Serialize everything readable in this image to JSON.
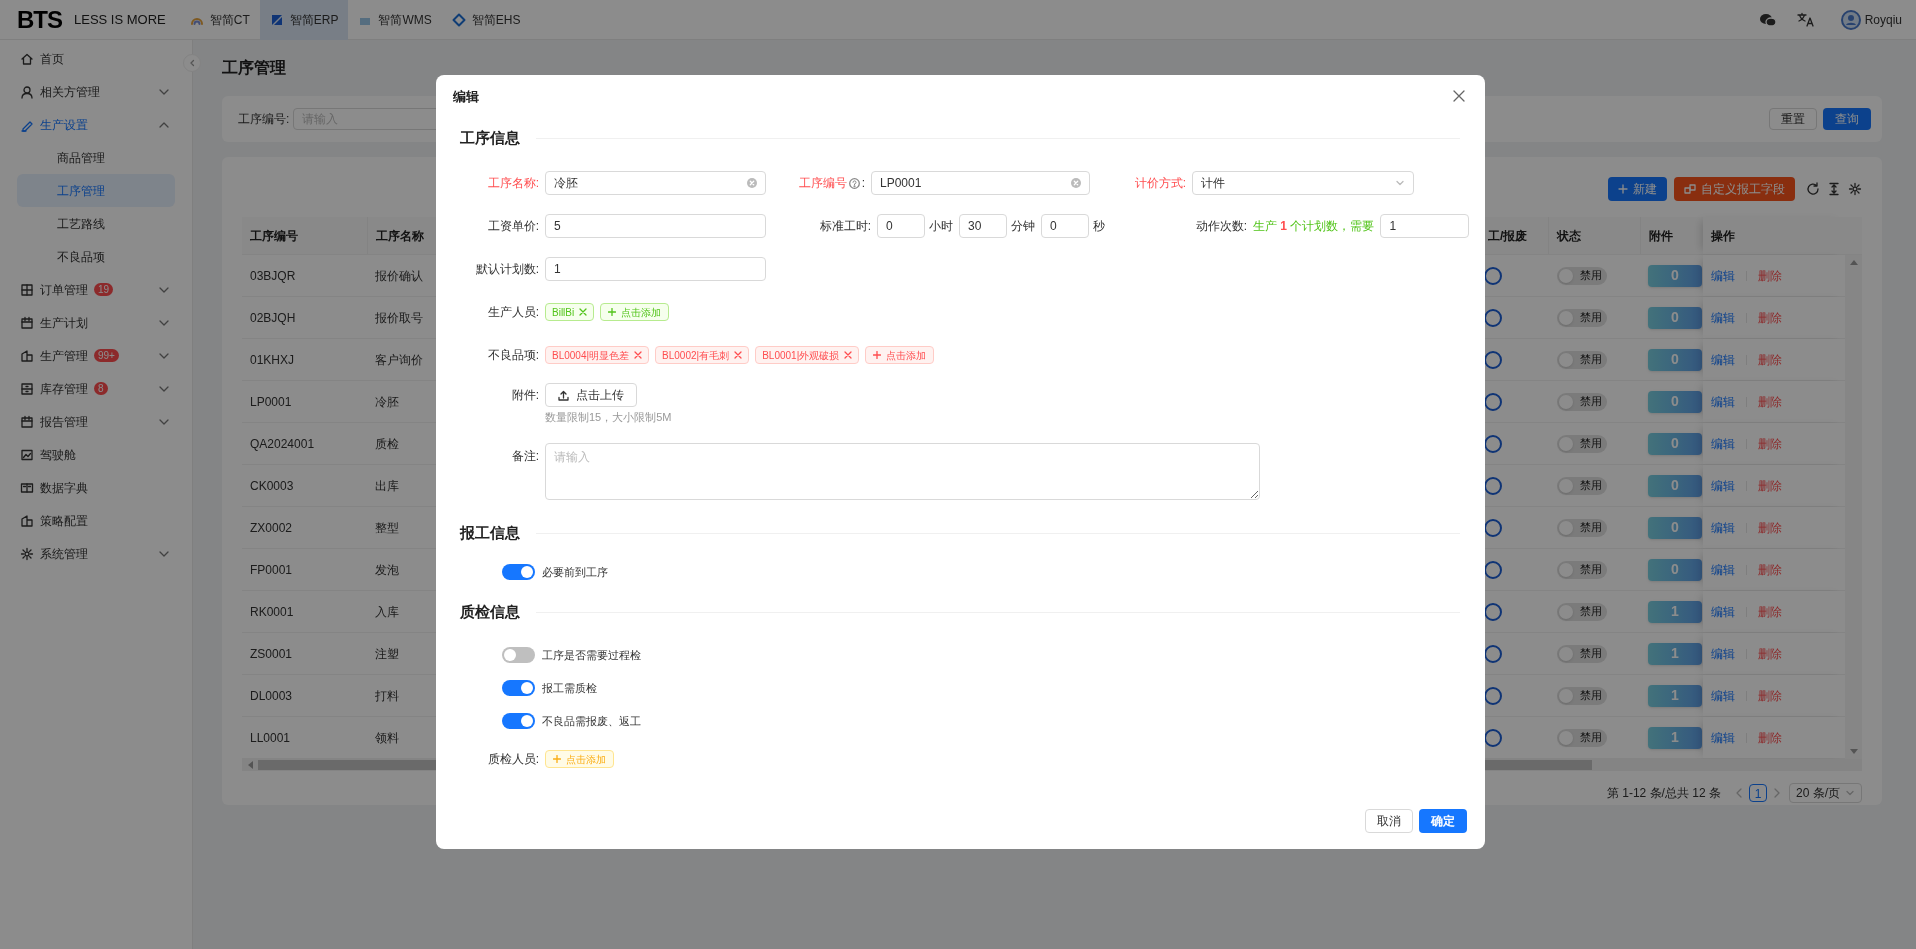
{
  "topbar": {
    "logo": "BTS",
    "slogan": "LESS IS MORE",
    "apps": [
      {
        "label": "智简CT",
        "selected": false
      },
      {
        "label": "智简ERP",
        "selected": true
      },
      {
        "label": "智简WMS",
        "selected": false
      },
      {
        "label": "智简EHS",
        "selected": false
      }
    ],
    "user": "Royqiu"
  },
  "sidebar": {
    "items": [
      {
        "label": "首页",
        "selected": false
      },
      {
        "label": "相关方管理",
        "selected": false,
        "expanded": false
      },
      {
        "label": "生产设置",
        "selected": true,
        "expanded": true,
        "children": [
          {
            "label": "商品管理",
            "selected": false
          },
          {
            "label": "工序管理",
            "selected": true
          },
          {
            "label": "工艺路线",
            "selected": false
          },
          {
            "label": "不良品项",
            "selected": false
          }
        ]
      },
      {
        "label": "订单管理",
        "selected": false,
        "expanded": false,
        "badge": "19"
      },
      {
        "label": "生产计划",
        "selected": false,
        "expanded": false
      },
      {
        "label": "生产管理",
        "selected": false,
        "expanded": false,
        "badge": "99+"
      },
      {
        "label": "库存管理",
        "selected": false,
        "expanded": false,
        "badge": "8"
      },
      {
        "label": "报告管理",
        "selected": false,
        "expanded": false
      },
      {
        "label": "驾驶舱",
        "selected": false
      },
      {
        "label": "数据字典",
        "selected": false
      },
      {
        "label": "策略配置",
        "selected": false
      },
      {
        "label": "系统管理",
        "selected": false,
        "expanded": false
      }
    ]
  },
  "page_title": "工序管理",
  "filter": {
    "label": "工序编号:",
    "placeholder": "请输入",
    "buttons": [
      {
        "label": "重置",
        "primary": false
      },
      {
        "label": "查询",
        "primary": true
      }
    ]
  },
  "toolbar": {
    "new_button": "新建",
    "custom_button": "自定义报工字段"
  },
  "table": {
    "columns": [
      "工序编号",
      "工序名称",
      "工/报废",
      "状态",
      "附件",
      "操作"
    ],
    "rows": [
      {
        "code": "03BJQR",
        "name": "报价确认",
        "status": {
          "on": false,
          "label": "禁用"
        },
        "attachments": "0",
        "actions": [
          "编辑",
          "删除"
        ]
      },
      {
        "code": "02BJQH",
        "name": "报价取号",
        "status": {
          "on": false,
          "label": "禁用"
        },
        "attachments": "0",
        "actions": [
          "编辑",
          "删除"
        ]
      },
      {
        "code": "01KHXJ",
        "name": "客户询价",
        "status": {
          "on": false,
          "label": "禁用"
        },
        "attachments": "0",
        "actions": [
          "编辑",
          "删除"
        ]
      },
      {
        "code": "LP0001",
        "name": "冷胚",
        "status": {
          "on": false,
          "label": "禁用"
        },
        "attachments": "0",
        "actions": [
          "编辑",
          "删除"
        ]
      },
      {
        "code": "QA2024001",
        "name": "质检",
        "status": {
          "on": false,
          "label": "禁用"
        },
        "attachments": "0",
        "actions": [
          "编辑",
          "删除"
        ]
      },
      {
        "code": "CK0003",
        "name": "出库",
        "status": {
          "on": false,
          "label": "禁用"
        },
        "attachments": "0",
        "actions": [
          "编辑",
          "删除"
        ]
      },
      {
        "code": "ZX0002",
        "name": "整型",
        "status": {
          "on": false,
          "label": "禁用"
        },
        "attachments": "0",
        "actions": [
          "编辑",
          "删除"
        ]
      },
      {
        "code": "FP0001",
        "name": "发泡",
        "status": {
          "on": false,
          "label": "禁用"
        },
        "attachments": "0",
        "actions": [
          "编辑",
          "删除"
        ]
      },
      {
        "code": "RK0001",
        "name": "入库",
        "status": {
          "on": false,
          "label": "禁用"
        },
        "attachments": "1",
        "actions": [
          "编辑",
          "删除"
        ]
      },
      {
        "code": "ZS0001",
        "name": "注塑",
        "status": {
          "on": false,
          "label": "禁用"
        },
        "attachments": "1",
        "actions": [
          "编辑",
          "删除"
        ]
      },
      {
        "code": "DL0003",
        "name": "打料",
        "status": {
          "on": false,
          "label": "禁用"
        },
        "attachments": "1",
        "actions": [
          "编辑",
          "删除"
        ]
      },
      {
        "code": "LL0001",
        "name": "领料",
        "status": {
          "on": false,
          "label": "禁用"
        },
        "attachments": "1",
        "actions": [
          "编辑",
          "删除"
        ]
      }
    ]
  },
  "pagination": {
    "summary": "第 1-12 条/总共 12 条",
    "pages": [
      {
        "label": "1",
        "selected": true
      }
    ],
    "page_size": "20 条/页"
  },
  "modal": {
    "title": "编辑",
    "process_info": {
      "title": "工序信息",
      "name": {
        "label": "工序名称:",
        "required": true,
        "value": "冷胚"
      },
      "code": {
        "label": "工序编号",
        "colon": ":",
        "required": true,
        "value": "LP0001"
      },
      "pricing": {
        "label": "计价方式:",
        "required": true,
        "value": "计件"
      },
      "wage": {
        "label": "工资单价:",
        "value": "5"
      },
      "std_time": {
        "label": "标准工时:",
        "parts": [
          {
            "value": "0",
            "unit": "小时"
          },
          {
            "value": "30",
            "unit": "分钟"
          },
          {
            "value": "0",
            "unit": "秒"
          }
        ]
      },
      "action_count": {
        "label": "动作次数:",
        "hint_before": "生产",
        "hint_number": "1",
        "hint_after": "个计划数，需要",
        "value": "1"
      },
      "default_plan": {
        "label": "默认计划数:",
        "value": "1"
      },
      "workers": {
        "label": "生产人员:",
        "kind": "success",
        "tags": [
          "BillBi"
        ],
        "add": "点击添加"
      },
      "defects": {
        "label": "不良品项:",
        "kind": "error",
        "tags": [
          "BL0004|明显色差",
          "BL0002|有毛刺",
          "BL0001|外观破损"
        ],
        "add": "点击添加"
      },
      "attachment": {
        "label": "附件:",
        "button": "点击上传",
        "hint": "数量限制15，大小限制5M"
      },
      "remark": {
        "label": "备注:",
        "placeholder": "请输入"
      }
    },
    "report_info": {
      "title": "报工信息",
      "switches": [
        {
          "label": "必要前到工序",
          "on": true
        }
      ]
    },
    "qc_info": {
      "title": "质检信息",
      "switches": [
        {
          "label": "工序是否需要过程检",
          "on": false
        },
        {
          "label": "报工需质检",
          "on": true
        },
        {
          "label": "不良品需报废、返工",
          "on": true
        }
      ],
      "inspectors": {
        "label": "质检人员:",
        "kind": "warning",
        "add": "点击添加"
      }
    },
    "buttons": [
      {
        "label": "取消",
        "primary": false
      },
      {
        "label": "确定",
        "primary": true
      }
    ]
  }
}
